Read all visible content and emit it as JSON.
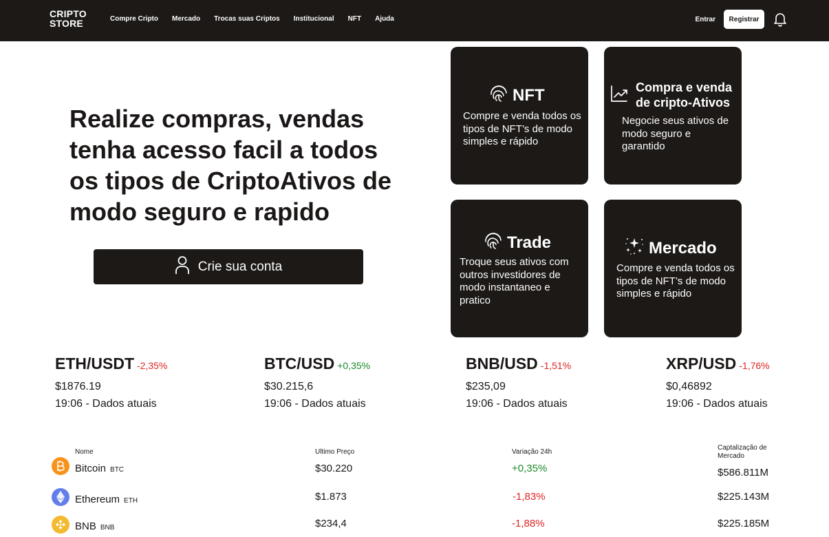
{
  "header": {
    "logo_line1": "CRIPTO",
    "logo_line2": "STORE",
    "nav": [
      "Compre Cripto",
      "Mercado",
      "Trocas suas Criptos",
      "Institucional",
      "NFT",
      "Ajuda"
    ],
    "login": "Entrar",
    "register": "Registrar",
    "bell_icon": "bell-icon"
  },
  "hero": {
    "title": "Realize compras, vendas tenha acesso facil a todos os tipos de CriptoAtivos de modo seguro e rapido",
    "cta_label": "Crie sua conta",
    "cta_icon": "user-icon"
  },
  "cards": [
    {
      "title": "NFT",
      "icon": "fingerprint-icon",
      "desc": "Compre e venda todos os tipos de NFT’s de modo simples e rápido"
    },
    {
      "title": "Compra e venda de cripto-Ativos",
      "icon": "chart-line-icon",
      "desc": "Negocie seus ativos de modo seguro e garantido"
    },
    {
      "title": "Trade",
      "icon": "fingerprint-icon",
      "desc": "Troque seus ativos com outros investidores de modo instantaneo e pratico"
    },
    {
      "title": "Mercado",
      "icon": "sparkles-icon",
      "desc": "Compre e venda todos os tipos de NFT’s de modo simples e rápido"
    }
  ],
  "tickers": [
    {
      "pair": "ETH/USDT",
      "change": "-2,35%",
      "price": "$1876.19",
      "time": "19:06 - Dados atuais"
    },
    {
      "pair": "BTC/USD",
      "change": "+0,35%",
      "price": "$30.215,6",
      "time": "19:06 - Dados atuais"
    },
    {
      "pair": "BNB/USD",
      "change": "-1,51%",
      "price": "$235,09",
      "time": "19:06 - Dados atuais"
    },
    {
      "pair": "XRP/USD",
      "change": "-1,76%",
      "price": "$0,46892",
      "time": "19:06 - Dados atuais"
    }
  ],
  "table": {
    "headers": [
      "Nome",
      "Ultimo Preço",
      "Variação 24h",
      "Captalização de Mercado"
    ],
    "rows": [
      {
        "name": "Bitcoin",
        "symbol": "BTC",
        "icon": "bitcoin-icon",
        "price": "$30.220",
        "change": "+0,35%",
        "cap": "$586.811M"
      },
      {
        "name": "Ethereum",
        "symbol": "ETH",
        "icon": "ethereum-icon",
        "price": "$1.873",
        "change": "-1,83%",
        "cap": "$225.143M"
      },
      {
        "name": "BNB",
        "symbol": "BNB",
        "icon": "bnb-icon",
        "price": "$234,4",
        "change": "-1,88%",
        "cap": "$225.185M"
      }
    ]
  },
  "colors": {
    "dark": "#1c1917",
    "negative": "#e02424",
    "positive": "#1d8a2b",
    "bitcoin": "#f7931a",
    "ethereum": "#627eea",
    "bnb": "#f3ba2f"
  }
}
